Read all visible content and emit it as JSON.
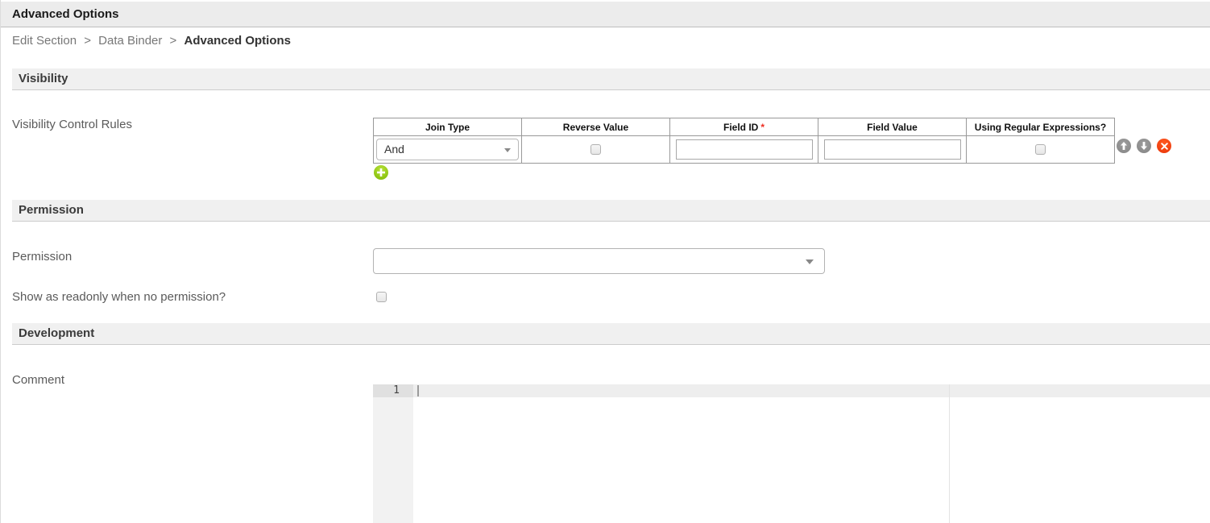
{
  "page_title": "Advanced Options",
  "breadcrumb": {
    "link1": "Edit Section",
    "link2": "Data Binder",
    "separator": ">",
    "current": "Advanced Options"
  },
  "visibility": {
    "header": "Visibility",
    "rules_label": "Visibility Control Rules",
    "table": {
      "columns": [
        "Join Type",
        "Reverse Value",
        "Field ID",
        "Field Value",
        "Using Regular Expressions?"
      ],
      "required_marker": "*",
      "row": {
        "join_type": "And",
        "reverse_value_checked": false,
        "field_id_value": "",
        "field_value_value": "",
        "using_regex_checked": false
      }
    },
    "icons": {
      "move_up": "arrow-up-circle",
      "move_down": "arrow-down-circle",
      "delete": "x-circle",
      "add": "plus-circle",
      "dropdown": "chevron-down"
    }
  },
  "permission": {
    "header": "Permission",
    "label": "Permission",
    "selected_value": "",
    "readonly_label": "Show as readonly when no permission?",
    "readonly_checked": false
  },
  "development": {
    "header": "Development",
    "comment_label": "Comment",
    "editor": {
      "line_number": "1",
      "content": ""
    }
  },
  "colors": {
    "topbar_bg": "#ececec",
    "section_bar_bg": "#f0f0f0",
    "required_red": "#ee2d20",
    "add_green": "#7cb802",
    "delete_red": "#e93408",
    "move_gray": "#8d8d8d"
  }
}
